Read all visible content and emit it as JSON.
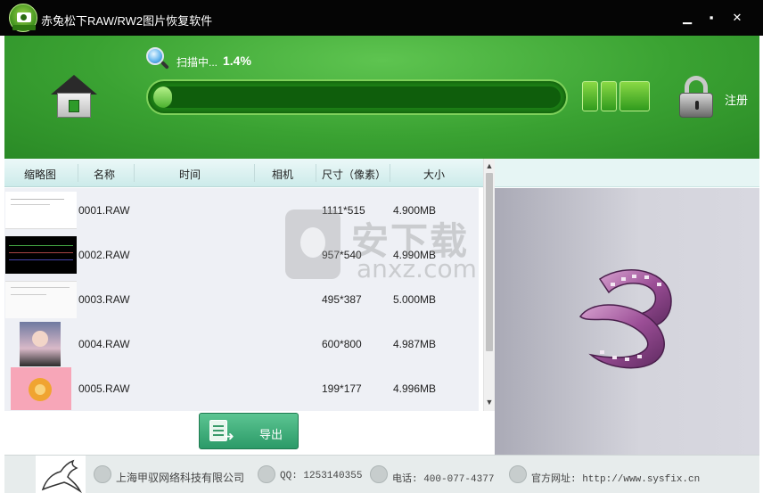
{
  "window": {
    "title": "赤兔松下RAW/RW2图片恢复软件",
    "minimize_glyph": "▁",
    "maximize_glyph": "▪",
    "close_glyph": "✕"
  },
  "header": {
    "scan_status": "扫描中...",
    "scan_percent": "1.4%",
    "progress_fraction": 0.014,
    "register_label": "注册"
  },
  "table": {
    "columns": [
      "缩略图",
      "名称",
      "时间",
      "相机",
      "尺寸（像素）",
      "大小"
    ],
    "rows": [
      {
        "name": "0001.RAW",
        "time": "",
        "camera": "",
        "dimensions": "1111*515",
        "size": "4.900MB"
      },
      {
        "name": "0002.RAW",
        "time": "",
        "camera": "",
        "dimensions": "957*540",
        "size": "4.990MB"
      },
      {
        "name": "0003.RAW",
        "time": "",
        "camera": "",
        "dimensions": "495*387",
        "size": "5.000MB"
      },
      {
        "name": "0004.RAW",
        "time": "",
        "camera": "",
        "dimensions": "600*800",
        "size": "4.987MB"
      },
      {
        "name": "0005.RAW",
        "time": "",
        "camera": "",
        "dimensions": "199*177",
        "size": "4.996MB"
      }
    ],
    "scroll_up": "▲",
    "scroll_down": "▼"
  },
  "export_label": "导出",
  "watermark": {
    "cn": "安下载",
    "en": "anxz.com"
  },
  "footer": {
    "company": "上海甲驭网络科技有限公司",
    "qq": "QQ: 1253140355",
    "phone": "电话: 400-077-4377",
    "website": "官方网址: http://www.sysfix.cn"
  },
  "colors": {
    "titlebar": "#050505",
    "header_green": "#3aa232",
    "progress_fill": "#8ee263",
    "export_green": "#2b9a68",
    "preview_bg": "#c8c8d0"
  },
  "icons": {
    "app": "app-camera-icon",
    "home": "home-icon",
    "search": "magnifier-icon",
    "view": "view-toggle-icon",
    "lock": "lock-icon",
    "export": "export-icon",
    "film": "film-reel-icon"
  }
}
